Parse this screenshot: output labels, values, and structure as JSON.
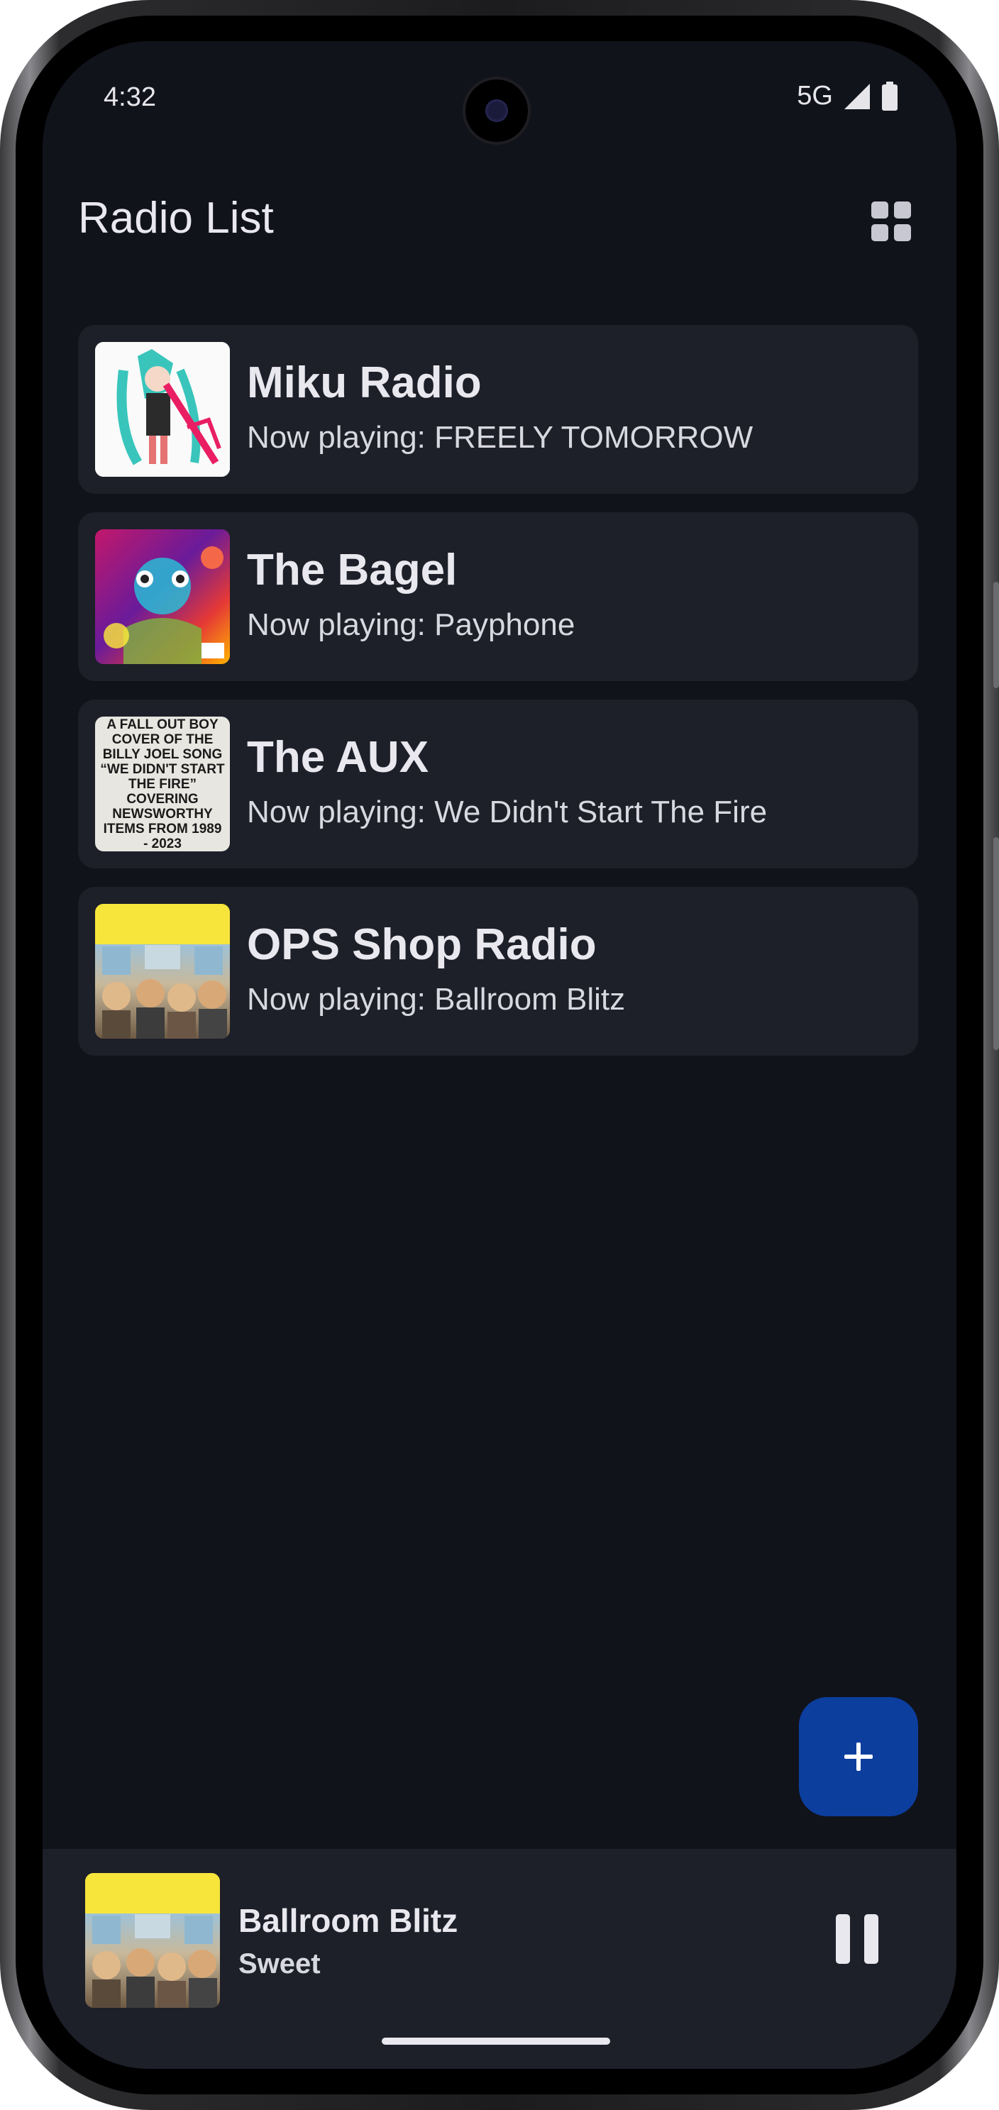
{
  "status_bar": {
    "time": "4:32",
    "network": "5G"
  },
  "header": {
    "title": "Radio List",
    "view_toggle_icon": "grid-view-icon"
  },
  "stations": [
    {
      "name": "Miku Radio",
      "now_playing": "Now playing: FREELY TOMORROW",
      "art": "miku-album-art"
    },
    {
      "name": "The Bagel",
      "now_playing": "Now playing: Payphone",
      "art": "overexposed-album-art"
    },
    {
      "name": "The AUX",
      "now_playing": "Now playing: We Didn't Start The Fire",
      "art": "fall-out-boy-cover-art",
      "art_text": "A FALL OUT BOY COVER OF THE BILLY JOEL SONG “WE DIDN'T START THE FIRE” COVERING NEWSWORTHY ITEMS FROM 1989 - 2023"
    },
    {
      "name": "OPS Shop Radio",
      "now_playing": "Now playing: Ballroom Blitz",
      "art": "sweet-album-art"
    }
  ],
  "fab": {
    "icon": "plus-icon"
  },
  "mini_player": {
    "title": "Ballroom Blitz",
    "artist": "Sweet",
    "control_icon": "pause-icon"
  },
  "colors": {
    "background": "#11131b",
    "card": "#1d1f29",
    "fab": "#0c3e9e",
    "text": "#e8e8ee"
  }
}
